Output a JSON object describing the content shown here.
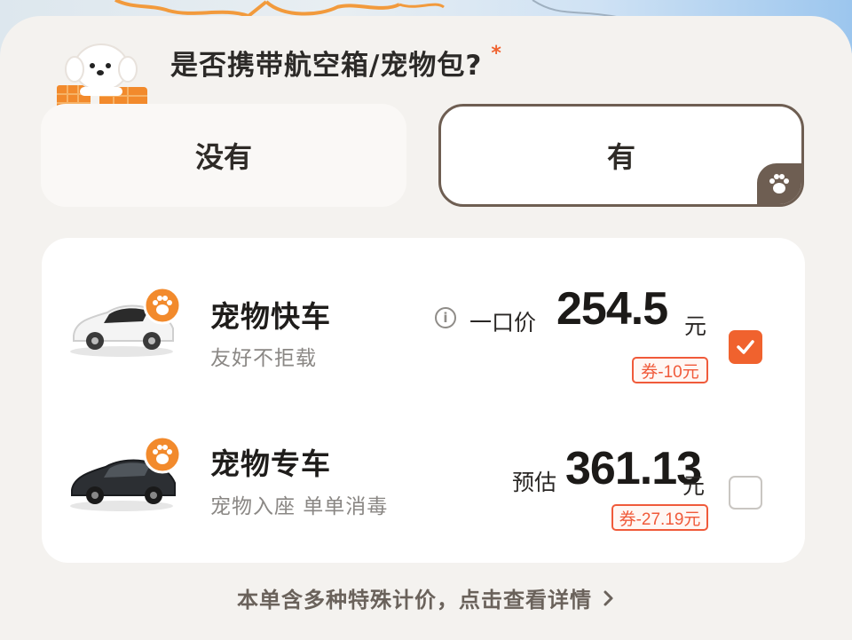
{
  "question": {
    "text": "是否携带航空箱/宠物包?",
    "required_mark": "*"
  },
  "choices": [
    {
      "label": "没有",
      "selected": false
    },
    {
      "label": "有",
      "selected": true
    }
  ],
  "options": [
    {
      "title": "宠物快车",
      "subtitle": "友好不拒载",
      "price_label": "一口价",
      "price": "254.5",
      "unit": "元",
      "coupon": "券-10元",
      "checked": true
    },
    {
      "title": "宠物专车",
      "subtitle": "宠物入座 单单消毒",
      "price_label": "预估",
      "price": "361.13",
      "unit": "元",
      "coupon": "券-27.19元",
      "checked": false
    }
  ],
  "footer": {
    "text": "本单含多种特殊计价，点击查看详情"
  },
  "colors": {
    "accent": "#f0622e",
    "brown": "#6e5e52",
    "coupon_red": "#f05a3a"
  }
}
